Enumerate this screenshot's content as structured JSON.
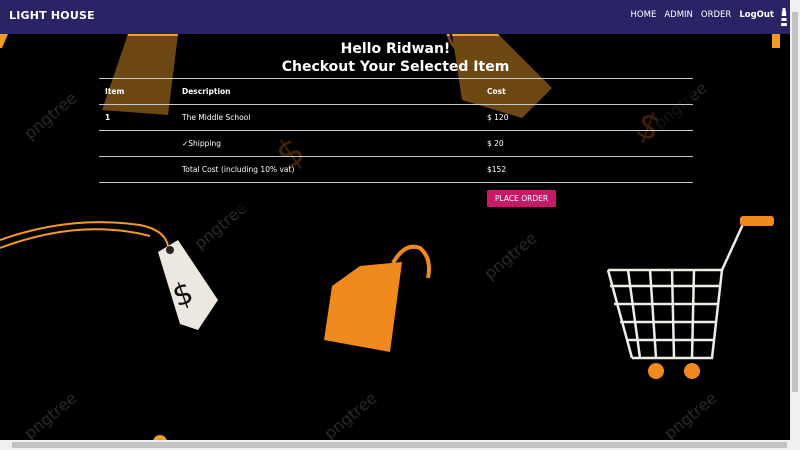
{
  "navbar": {
    "brand": "LIGHT HOUSE",
    "links": [
      "HOME",
      "ADMIN",
      "ORDER",
      "LogOut"
    ]
  },
  "greeting": {
    "line1": "Hello Ridwan!",
    "line2": "Checkout Your Selected Item"
  },
  "table": {
    "headers": [
      "Item",
      "Description",
      "Cost"
    ],
    "rows": [
      [
        "1",
        "The Middle School",
        "$ 120"
      ],
      [
        "",
        "✓Shipping",
        "$ 20"
      ],
      [
        "",
        "Total Cost (including 10% vat)",
        "$152"
      ]
    ]
  },
  "actions": {
    "place_order": "PLACE ORDER"
  },
  "colors": {
    "navbar": "#2a2466",
    "button": "#c8186a",
    "accent": "#f39a24"
  }
}
